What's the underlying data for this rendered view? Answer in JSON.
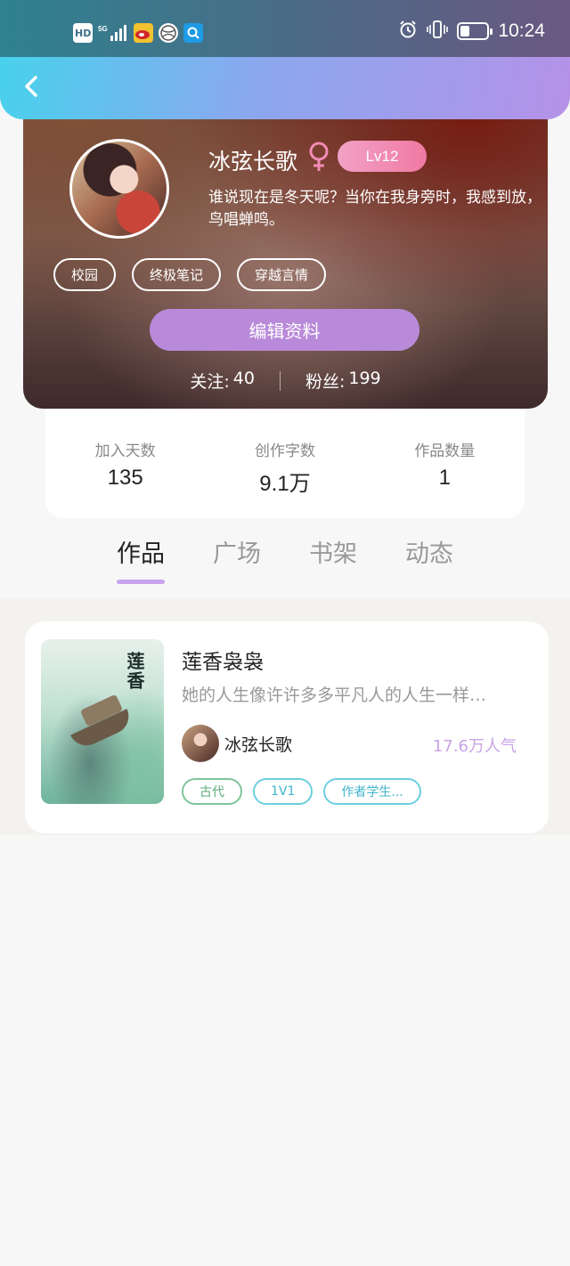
{
  "status_bar": {
    "time": "10:24",
    "left_icons": [
      "hd-icon",
      "signal-icon",
      "weibo-icon",
      "ball-icon",
      "search-app-icon"
    ],
    "battery_level": 0.35
  },
  "profile": {
    "nickname": "冰弦长歌",
    "gender": "female",
    "level": "Lv12",
    "bio": "谁说现在是冬天呢？当你在我身旁时，我感到放，鸟唱蝉鸣。",
    "tags": [
      "校园",
      "终极笔记",
      "穿越言情"
    ],
    "edit_label": "编辑资料",
    "following_label": "关注:",
    "following_count": "40",
    "fans_label": "粉丝:",
    "fans_count": "199"
  },
  "stats": [
    {
      "label": "加入天数",
      "value": "135"
    },
    {
      "label": "创作字数",
      "value": "9.1万"
    },
    {
      "label": "作品数量",
      "value": "1"
    }
  ],
  "tabs": [
    {
      "label": "作品",
      "active": true
    },
    {
      "label": "广场",
      "active": false
    },
    {
      "label": "书架",
      "active": false
    },
    {
      "label": "动态",
      "active": false
    }
  ],
  "works": [
    {
      "title": "莲香袅袅",
      "cover_title": "莲香",
      "description": "她的人生像许许多多平凡人的人生一样…",
      "author": "冰弦长歌",
      "popularity": "17.6万人气",
      "tags": [
        "古代",
        "1V1",
        "作者学生..."
      ]
    }
  ],
  "colors": {
    "accent": "#b98ad9",
    "tab_indicator": "#c9a3ee",
    "level_badge": "#f07aa2",
    "popularity": "#c9a3e6"
  }
}
